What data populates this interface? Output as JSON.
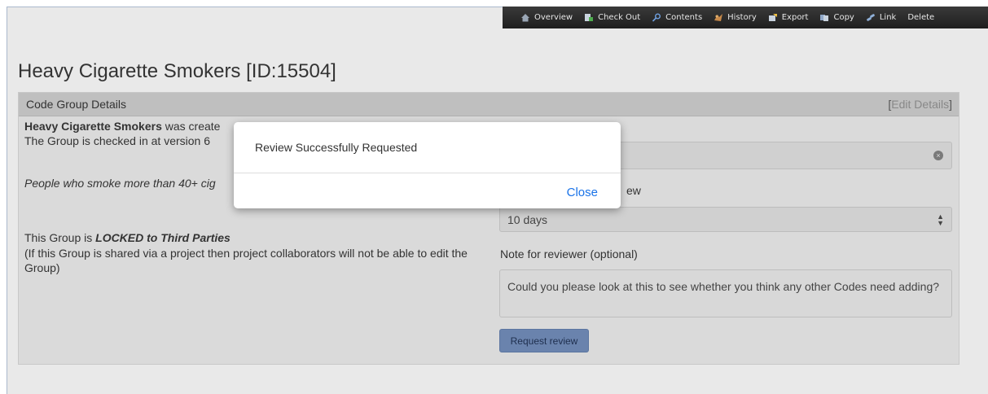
{
  "toolbar": {
    "items": [
      {
        "label": "Overview",
        "icon": "home-icon"
      },
      {
        "label": "Check Out",
        "icon": "checkout-icon"
      },
      {
        "label": "Contents",
        "icon": "search-icon"
      },
      {
        "label": "History",
        "icon": "history-icon"
      },
      {
        "label": "Export",
        "icon": "export-icon"
      },
      {
        "label": "Copy",
        "icon": "copy-icon"
      },
      {
        "label": "Link",
        "icon": "link-icon"
      },
      {
        "label": "Delete",
        "icon": ""
      }
    ]
  },
  "page": {
    "title": "Heavy Cigarette Smokers [ID:15504]"
  },
  "panel": {
    "heading": "Code Group Details",
    "edit_link": "Edit Details",
    "bracket_open": "[",
    "bracket_close": "]",
    "group_name": "Heavy Cigarette Smokers",
    "created_by_visible": "was create",
    "checked_in_text": "The Group is checked in at version 6",
    "description_visible": "People who smoke more than 40+ cig",
    "locked_prefix": "This Group is ",
    "locked_emphasis": "LOCKED to Third Parties",
    "locked_note": "(If this Group is shared via a project then project collaborators will not be able to edit the Group)"
  },
  "review_form": {
    "timeframe_label_fragment": "ew",
    "timeframe_value": "10 days",
    "note_label": "Note for reviewer (optional)",
    "note_value": "Could you please look at this to see whether you think any other Codes need adding?",
    "request_button": "Request review"
  },
  "modal": {
    "message": "Review Successfully Requested",
    "close_label": "Close"
  },
  "colors": {
    "toolbar_bg": "#2a2a2a",
    "button_bg": "#6a83ad",
    "link_blue": "#1a73e8"
  }
}
